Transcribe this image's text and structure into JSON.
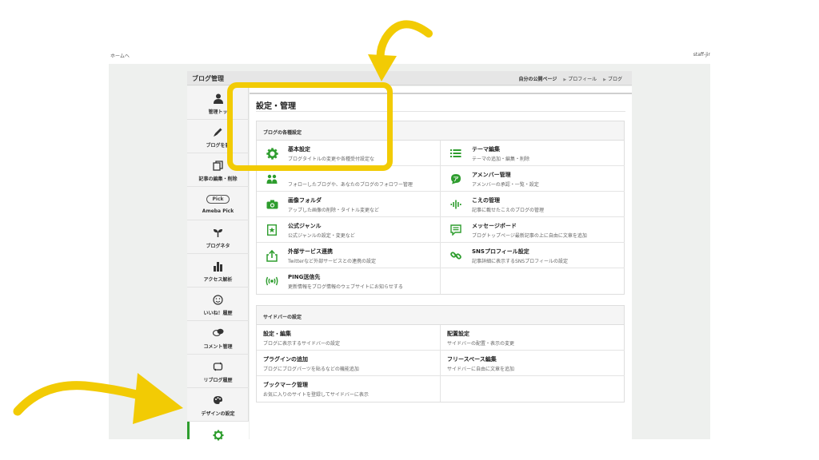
{
  "topbar": {
    "home": "ホームへ",
    "user": "staff-jir"
  },
  "header": {
    "title": "ブログ管理",
    "public_page": "自分の公開ページ",
    "profile": "プロフィール",
    "blog": "ブログ"
  },
  "sidebar": {
    "items": [
      {
        "label": "管理トッ",
        "icon": "person-icon"
      },
      {
        "label": "ブログを書",
        "icon": "pencil-icon"
      },
      {
        "label": "記事の編集・削除",
        "icon": "documents-icon"
      },
      {
        "label": "Ameba Pick",
        "icon": "pick-icon",
        "badge": "Pick"
      },
      {
        "label": "ブログネタ",
        "icon": "sprout-icon"
      },
      {
        "label": "アクセス解析",
        "icon": "bar-chart-icon"
      },
      {
        "label": "いいね！履歴",
        "icon": "smile-icon"
      },
      {
        "label": "コメント管理",
        "icon": "comment-icon"
      },
      {
        "label": "リブログ履歴",
        "icon": "reblog-icon"
      },
      {
        "label": "デザインの設定",
        "icon": "palette-icon"
      },
      {
        "label": "",
        "icon": "gear-icon"
      }
    ]
  },
  "main": {
    "title": "設定・管理",
    "section1": {
      "heading": "ブログの各種設定",
      "items": [
        {
          "title": "基本設定",
          "desc": "ブログタイトルの変更や各種受付設定な",
          "icon": "gear-icon"
        },
        {
          "title": "テーマ編集",
          "desc": "テーマの追加・編集・削除",
          "icon": "list-icon"
        },
        {
          "title": "",
          "desc": "フォローしたブログや、あなたのブログのフォロワー管理",
          "icon": "followers-icon"
        },
        {
          "title": "アメンバー管理",
          "desc": "アメンバーの承認・一覧・設定",
          "icon": "amember-icon"
        },
        {
          "title": "画像フォルダ",
          "desc": "アップした画像の削除・タイトル変更など",
          "icon": "camera-icon"
        },
        {
          "title": "こえの管理",
          "desc": "記事に載せたこえのブログの管理",
          "icon": "voice-icon"
        },
        {
          "title": "公式ジャンル",
          "desc": "公式ジャンルの設定・変更など",
          "icon": "star-bookmark-icon"
        },
        {
          "title": "メッセージボード",
          "desc": "ブログトップページ最新記事の上に自由に文章を追加",
          "icon": "message-board-icon"
        },
        {
          "title": "外部サービス連携",
          "desc": "Twitterなど外部サービスとの連携の設定",
          "icon": "share-icon"
        },
        {
          "title": "SNSプロフィール設定",
          "desc": "記事詳細に表示するSNSプロフィールの設定",
          "icon": "link-icon"
        },
        {
          "title": "PING送信先",
          "desc": "更新情報をブログ情報のウェブサイトにお知らせする",
          "icon": "ping-icon"
        },
        {
          "title": "",
          "desc": "",
          "icon": ""
        }
      ]
    },
    "section2": {
      "heading": "サイドバーの設定",
      "items": [
        {
          "title": "設定・編集",
          "desc": "ブログに表示するサイドバーの設定"
        },
        {
          "title": "配置設定",
          "desc": "サイドバーの配置・表示の変更"
        },
        {
          "title": "プラグインの追加",
          "desc": "ブログにブログパーツを貼るなどの機能追加"
        },
        {
          "title": "フリースペース編集",
          "desc": "サイドバーに自由に文章を追加"
        },
        {
          "title": "ブックマーク管理",
          "desc": "お気に入りのサイトを登録してサイドバーに表示"
        },
        {
          "title": "",
          "desc": ""
        }
      ]
    }
  },
  "colors": {
    "accent_green": "#2e9d2e",
    "annotation_yellow": "#f2cb04"
  }
}
